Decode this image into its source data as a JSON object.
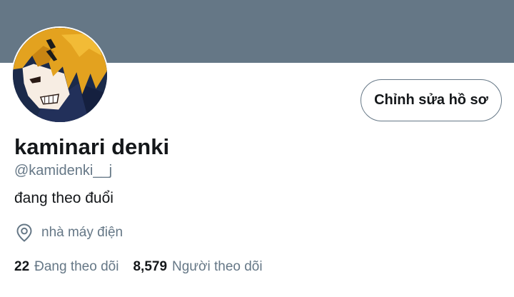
{
  "profile": {
    "display_name": "kaminari denki",
    "handle": "@kamidenki__j",
    "bio": "đang theo đuổi",
    "location": "nhà máy điện",
    "edit_button_label": "Chỉnh sửa hồ sơ"
  },
  "stats": {
    "following_count": "22",
    "following_label": "Đang theo dõi",
    "followers_count": "8,579",
    "followers_label": "Người theo dõi"
  },
  "icons": {
    "location": "location-pin-icon"
  },
  "colors": {
    "banner": "#657786",
    "secondary_text": "#657786",
    "primary_text": "#14171a"
  }
}
